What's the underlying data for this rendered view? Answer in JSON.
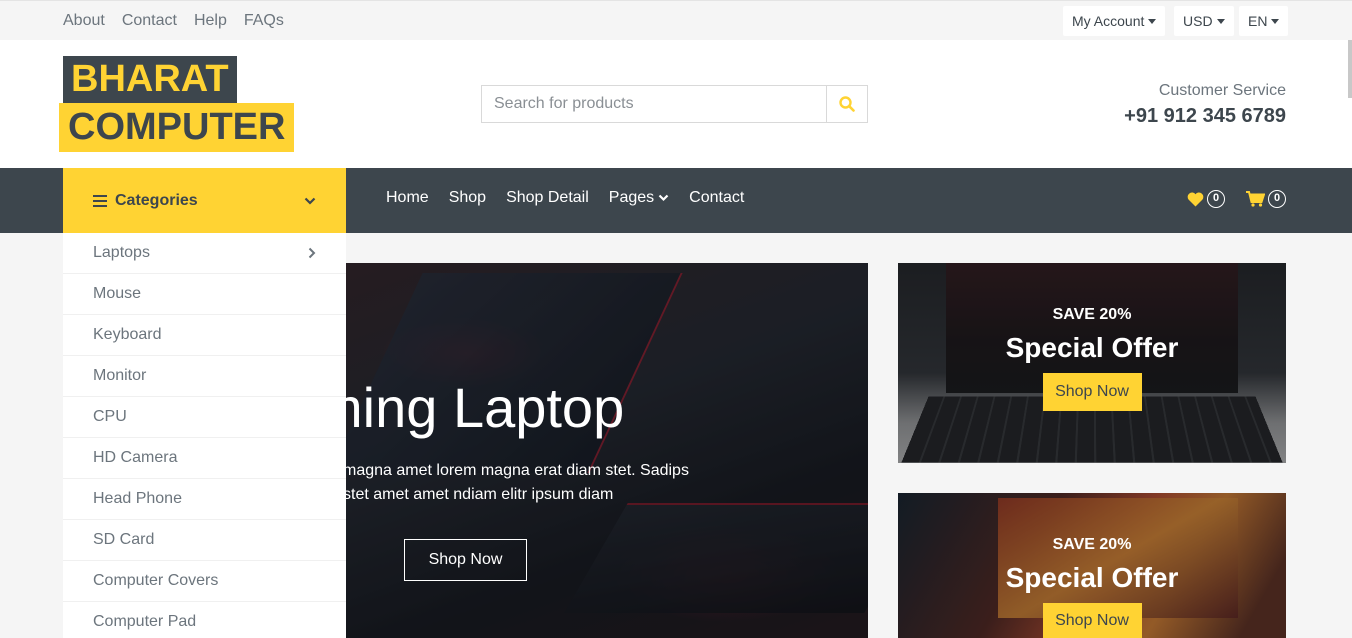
{
  "topbar": {
    "links": [
      "About",
      "Contact",
      "Help",
      "FAQs"
    ],
    "account": "My Account",
    "currency": "USD",
    "language": "EN"
  },
  "header": {
    "logo_line1": "BHARAT",
    "logo_line2": "COMPUTER",
    "search_placeholder": "Search for products",
    "customer_service_label": "Customer Service",
    "phone": "+91 912 345 6789"
  },
  "nav": {
    "categories_label": "Categories",
    "links": [
      "Home",
      "Shop",
      "Shop Detail",
      "Pages",
      "Contact"
    ],
    "wishlist_count": "0",
    "cart_count": "0"
  },
  "categories": [
    "Laptops",
    "Mouse",
    "Keyboard",
    "Monitor",
    "CPU",
    "HD Camera",
    "Head Phone",
    "SD Card",
    "Computer Covers",
    "Computer Pad"
  ],
  "hero": {
    "title": "ming Laptop",
    "text_line1": "magna amet lorem magna erat diam stet. Sadips",
    "text_line2": "stet amet amet ndiam elitr ipsum diam",
    "button": "Shop Now"
  },
  "offers": [
    {
      "save": "SAVE 20%",
      "title": "Special Offer",
      "button": "Shop Now"
    },
    {
      "save": "SAVE 20%",
      "title": "Special Offer",
      "button": "Shop Now"
    }
  ],
  "colors": {
    "accent": "#ffd333",
    "dark": "#3d464d",
    "muted": "#6c757d"
  },
  "icons": {
    "search": "search-icon",
    "wishlist": "heart-icon",
    "cart": "cart-icon",
    "menu": "bars-icon"
  }
}
